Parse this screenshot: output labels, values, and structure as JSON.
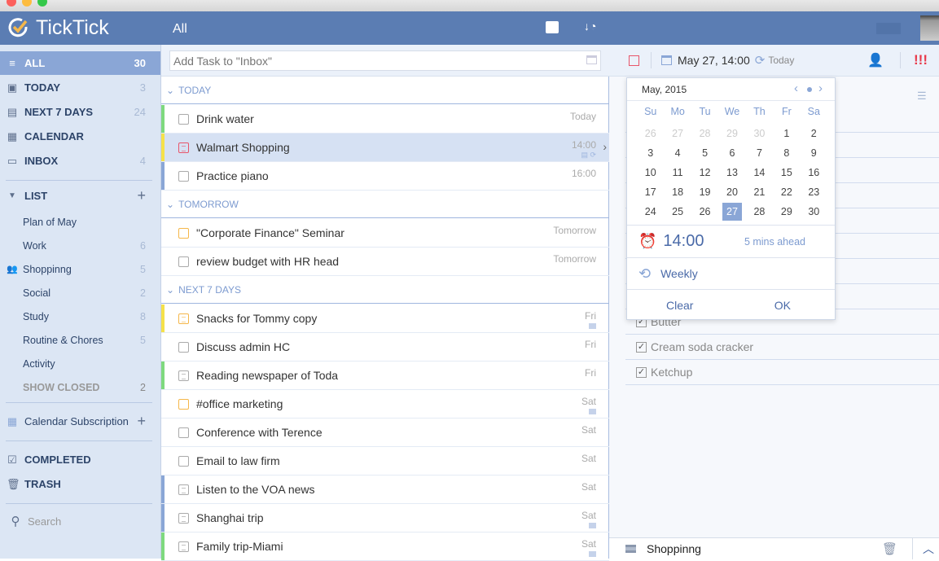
{
  "app": {
    "name": "TickTick",
    "accent": "#5b7db3"
  },
  "sidebar": {
    "smart": [
      {
        "label": "ALL",
        "count": "30",
        "icon": "inbox-stack-icon"
      },
      {
        "label": "TODAY",
        "count": "3",
        "icon": "calendar-27-icon"
      },
      {
        "label": "NEXT 7 DAYS",
        "count": "24",
        "icon": "calendar-week-icon"
      },
      {
        "label": "CALENDAR",
        "count": "",
        "icon": "calendar-icon"
      },
      {
        "label": "INBOX",
        "count": "4",
        "icon": "inbox-icon"
      }
    ],
    "list_header": "LIST",
    "lists": [
      {
        "label": "Plan of May",
        "count": ""
      },
      {
        "label": "Work",
        "count": "6"
      },
      {
        "label": "Shoppinng",
        "count": "5",
        "shared": true
      },
      {
        "label": "Social",
        "count": "2"
      },
      {
        "label": "Study",
        "count": "8"
      },
      {
        "label": "Routine & Chores",
        "count": "5"
      },
      {
        "label": "Activity",
        "count": ""
      }
    ],
    "show_closed": {
      "label": "SHOW CLOSED",
      "count": "2"
    },
    "calendar_subscription": "Calendar Subscription",
    "completed": "COMPLETED",
    "trash": "TRASH",
    "search_placeholder": "Search"
  },
  "main": {
    "title": "All",
    "add_placeholder": "Add Task to \"Inbox\"",
    "sections": [
      {
        "label": "TODAY",
        "tasks": [
          {
            "title": "Drink water",
            "due": "Today",
            "color": "#7ed97e",
            "kind": "check"
          },
          {
            "title": "Walmart Shopping",
            "due": "14:00",
            "color": "#f5e14a",
            "kind": "note",
            "selected": true,
            "box": "#e8556a",
            "icons": true
          },
          {
            "title": "Practice piano",
            "due": "16:00",
            "color": "#8aa6d6",
            "kind": "check"
          }
        ]
      },
      {
        "label": "TOMORROW",
        "tasks": [
          {
            "title": "\"Corporate Finance\" Seminar",
            "due": "Tomorrow",
            "color": "",
            "kind": "check",
            "box": "#f5b74a"
          },
          {
            "title": "review budget with HR head",
            "due": "Tomorrow",
            "color": "",
            "kind": "check"
          }
        ]
      },
      {
        "label": "NEXT 7 DAYS",
        "tasks": [
          {
            "title": "Snacks for Tommy copy",
            "due": "Fri",
            "color": "#f5e14a",
            "kind": "note",
            "box": "#f5b74a",
            "mini": true
          },
          {
            "title": "Discuss admin HC",
            "due": "Fri",
            "color": "",
            "kind": "check"
          },
          {
            "title": "Reading newspaper of Toda",
            "due": "Fri",
            "color": "#7ed97e",
            "kind": "note"
          },
          {
            "title": "#office marketing",
            "due": "Sat",
            "color": "",
            "kind": "check",
            "box": "#f5b74a",
            "mini": true
          },
          {
            "title": "Conference with Terence",
            "due": "Sat",
            "color": "",
            "kind": "check"
          },
          {
            "title": "Email to law firm",
            "due": "Sat",
            "color": "",
            "kind": "check"
          },
          {
            "title": "Listen to the VOA news",
            "due": "Sat",
            "color": "#8aa6d6",
            "kind": "note"
          },
          {
            "title": "Shanghai trip",
            "due": "Sat",
            "color": "#8aa6d6",
            "kind": "note",
            "mini": true
          },
          {
            "title": "Family trip-Miami",
            "due": "Sat",
            "color": "#7ed97e",
            "kind": "note",
            "mini": true
          }
        ]
      }
    ]
  },
  "detail": {
    "date": "May 27, 14:00",
    "repeat_label": "Today",
    "priority": "!!!",
    "priority_color": "#e8394a",
    "checklist": [
      {
        "text": "Butter",
        "checked": true
      },
      {
        "text": "Cream soda cracker",
        "checked": true
      },
      {
        "text": "Ketchup",
        "checked": true
      }
    ],
    "list_name": "Shoppinng"
  },
  "datepicker": {
    "month": "May, 2015",
    "weekdays": [
      "Su",
      "Mo",
      "Tu",
      "We",
      "Th",
      "Fr",
      "Sa"
    ],
    "weeks": [
      [
        "26",
        "27",
        "28",
        "29",
        "30",
        "1",
        "2"
      ],
      [
        "3",
        "4",
        "5",
        "6",
        "7",
        "8",
        "9"
      ],
      [
        "10",
        "11",
        "12",
        "13",
        "14",
        "15",
        "16"
      ],
      [
        "17",
        "18",
        "19",
        "20",
        "21",
        "22",
        "23"
      ],
      [
        "24",
        "25",
        "26",
        "27",
        "28",
        "29",
        "30"
      ]
    ],
    "selected": "27",
    "time": "14:00",
    "reminder": "5 mins ahead",
    "repeat": "Weekly",
    "clear": "Clear",
    "ok": "OK"
  }
}
